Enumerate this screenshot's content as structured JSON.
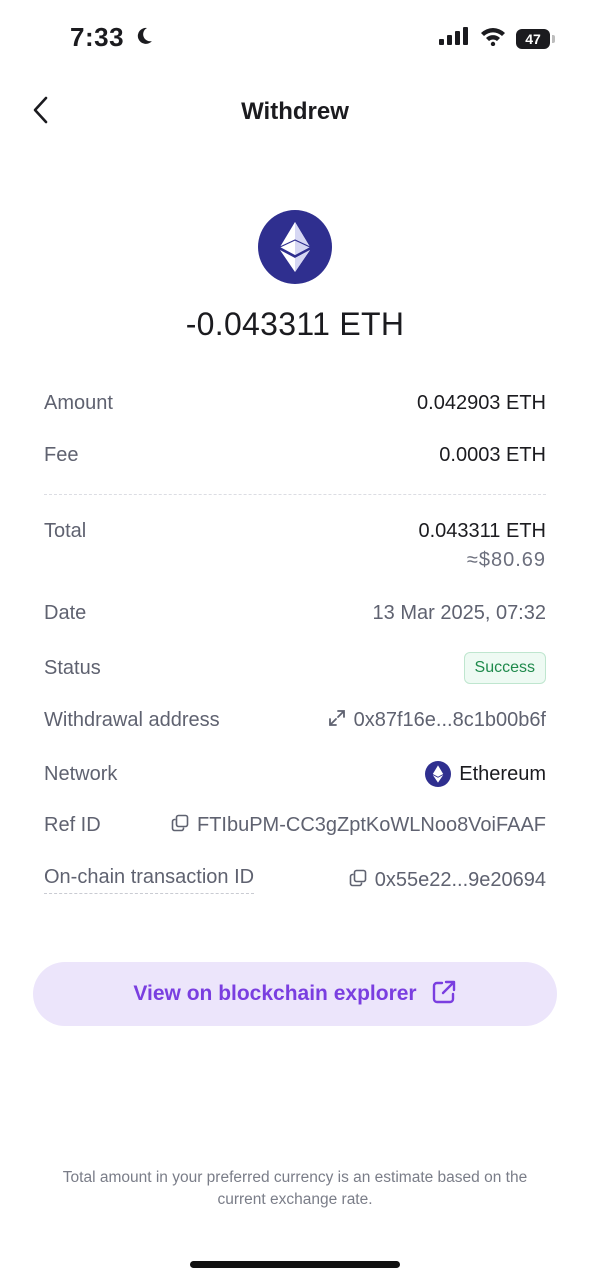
{
  "status_bar": {
    "time": "7:33",
    "battery": "47",
    "icons": [
      "moon-icon",
      "cellular-signal-icon",
      "wifi-icon",
      "battery-icon"
    ]
  },
  "header": {
    "title": "Withdrew",
    "back_icon": "chevron-left-icon"
  },
  "summary": {
    "coin_icon": "ethereum-icon",
    "amount": "-0.043311 ETH"
  },
  "details": {
    "amount_label": "Amount",
    "amount_value": "0.042903 ETH",
    "fee_label": "Fee",
    "fee_value": "0.0003 ETH",
    "total_label": "Total",
    "total_value": "0.043311 ETH",
    "total_fiat": "≈$80.69",
    "date_label": "Date",
    "date_value": "13 Mar 2025, 07:32",
    "status_label": "Status",
    "status_value": "Success",
    "address_label": "Withdrawal address",
    "address_value": "0x87f16e...8c1b00b6f",
    "network_label": "Network",
    "network_value": "Ethereum",
    "ref_label": "Ref ID",
    "ref_value": "FTIbuPM-CC3gZptKoWLNoo8VoiFAAF",
    "onchain_label": "On-chain transaction ID",
    "onchain_value": "0x55e22...9e20694"
  },
  "cta": {
    "label": "View on blockchain explorer",
    "icon": "external-link-icon"
  },
  "footnote": "Total amount in your preferred currency is an estimate based on the current exchange rate.",
  "colors": {
    "accent": "#7a3ee0",
    "cta_bg": "#ece5fb",
    "eth": "#2f2f8f",
    "success": "#1f8a4c"
  }
}
